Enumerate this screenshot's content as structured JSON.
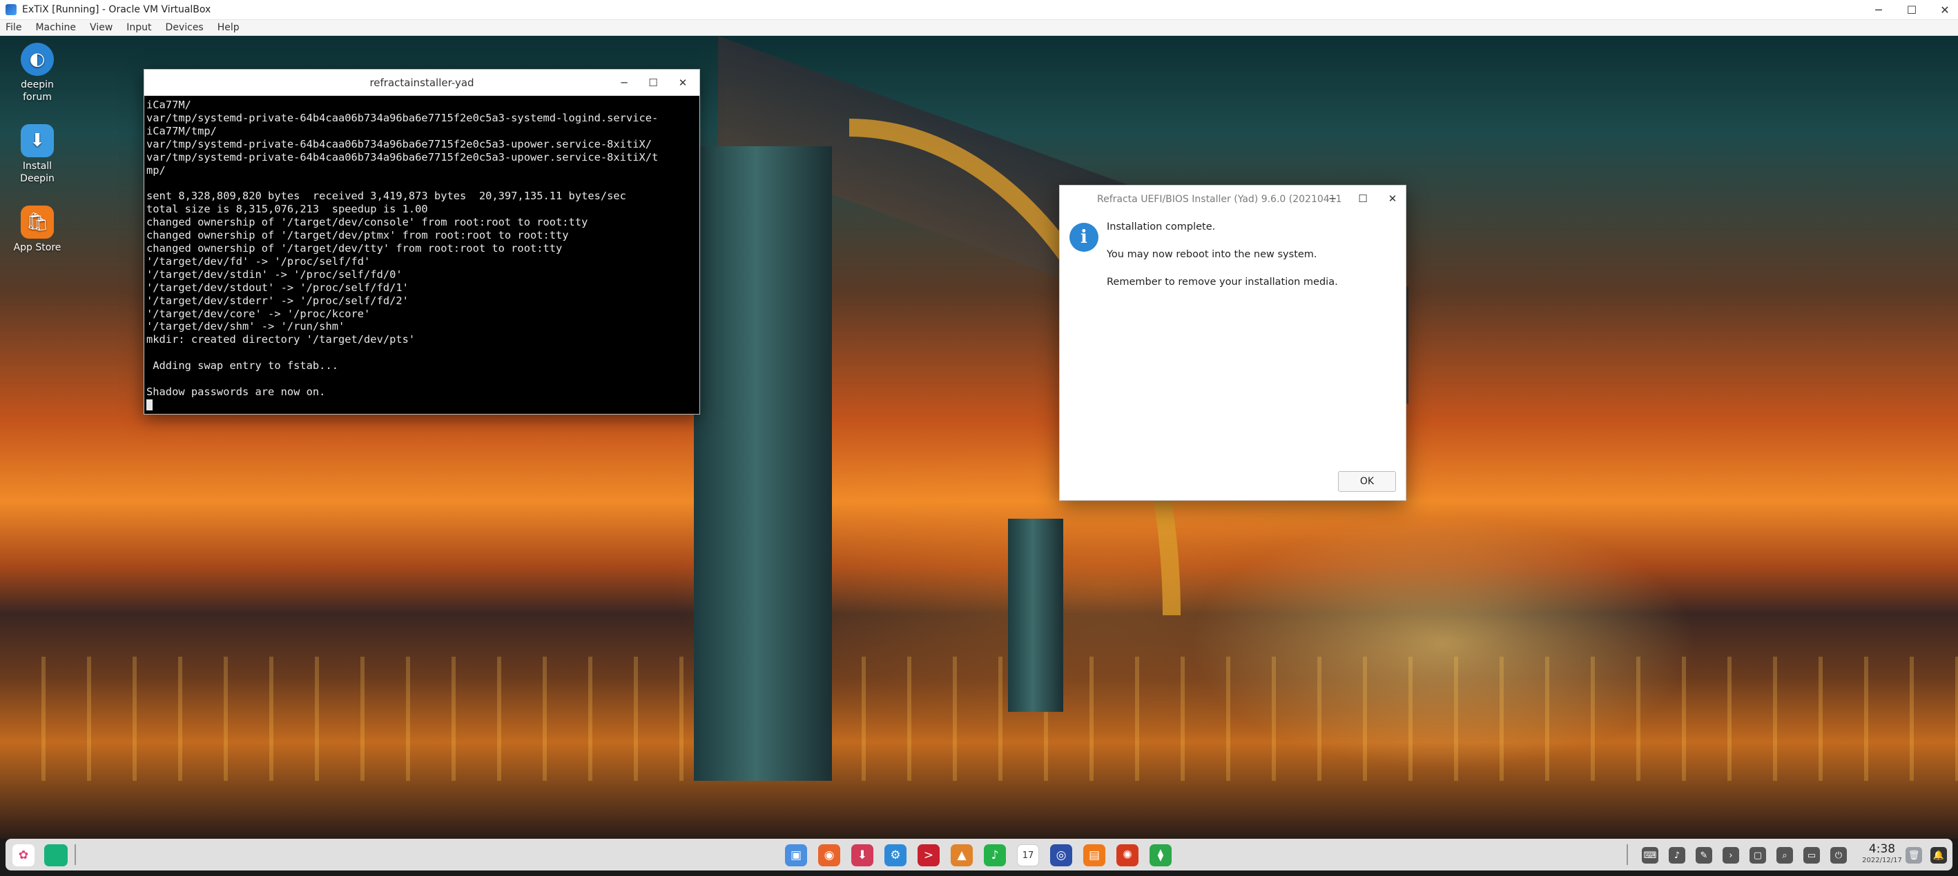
{
  "host": {
    "title": "ExTiX [Running] - Oracle VM VirtualBox",
    "menu": [
      "File",
      "Machine",
      "View",
      "Input",
      "Devices",
      "Help"
    ],
    "controls": {
      "minimize": "─",
      "maximize": "☐",
      "close": "✕"
    }
  },
  "desktop_icons": [
    {
      "label_line1": "deepin",
      "label_line2": "forum",
      "icon": "deepin-forum-icon",
      "glyph": "◐"
    },
    {
      "label_line1": "Install",
      "label_line2": "Deepin",
      "icon": "install-deepin-icon",
      "glyph": "⬇"
    },
    {
      "label_line1": "App Store",
      "label_line2": "",
      "icon": "app-store-icon",
      "glyph": "🛍"
    }
  ],
  "terminal": {
    "title": "refractainstaller-yad",
    "lines": [
      "iCa77M/",
      "var/tmp/systemd-private-64b4caa06b734a96ba6e7715f2e0c5a3-systemd-logind.service-",
      "iCa77M/tmp/",
      "var/tmp/systemd-private-64b4caa06b734a96ba6e7715f2e0c5a3-upower.service-8xitiX/",
      "var/tmp/systemd-private-64b4caa06b734a96ba6e7715f2e0c5a3-upower.service-8xitiX/t",
      "mp/",
      "",
      "sent 8,328,809,820 bytes  received 3,419,873 bytes  20,397,135.11 bytes/sec",
      "total size is 8,315,076,213  speedup is 1.00",
      "changed ownership of '/target/dev/console' from root:root to root:tty",
      "changed ownership of '/target/dev/ptmx' from root:root to root:tty",
      "changed ownership of '/target/dev/tty' from root:root to root:tty",
      "'/target/dev/fd' -> '/proc/self/fd'",
      "'/target/dev/stdin' -> '/proc/self/fd/0'",
      "'/target/dev/stdout' -> '/proc/self/fd/1'",
      "'/target/dev/stderr' -> '/proc/self/fd/2'",
      "'/target/dev/core' -> '/proc/kcore'",
      "'/target/dev/shm' -> '/run/shm'",
      "mkdir: created directory '/target/dev/pts'",
      "",
      " Adding swap entry to fstab...",
      "",
      "Shadow passwords are now on."
    ],
    "controls": {
      "minimize": "─",
      "maximize": "☐",
      "close": "✕"
    }
  },
  "dialog": {
    "title": "Refracta UEFI/BIOS Installer (Yad) 9.6.0 (20210411",
    "icon_glyph": "i",
    "message_1": "Installation complete.",
    "message_2": "You may now reboot into the new system.",
    "message_3": "Remember to remove your installation media.",
    "ok_label": "OK",
    "controls": {
      "minimize": "─",
      "maximize": "☐",
      "close": "✕"
    }
  },
  "dock": {
    "launcher_glyph": "✿",
    "left_items": [
      {
        "name": "launcher-icon",
        "color": "#ffffff"
      },
      {
        "name": "multitasking-view-icon",
        "color": "#16b27a"
      }
    ],
    "apps": [
      {
        "name": "file-manager-icon",
        "color": "#4a8fe0",
        "glyph": "▣"
      },
      {
        "name": "firefox-icon",
        "color": "#e8642a",
        "glyph": "◉"
      },
      {
        "name": "downloader-icon",
        "color": "#d23a5a",
        "glyph": "⬇"
      },
      {
        "name": "settings-gear-icon",
        "color": "#2e8ad8",
        "glyph": "⚙"
      },
      {
        "name": "terminal-icon",
        "color": "#c8202e",
        "glyph": ">"
      },
      {
        "name": "image-viewer-icon",
        "color": "#e0832a",
        "glyph": "▲"
      },
      {
        "name": "music-icon",
        "color": "#26b24a",
        "glyph": "♪"
      },
      {
        "name": "calendar-icon",
        "color": "#ffffff",
        "glyph": "17"
      },
      {
        "name": "system-monitor-icon",
        "color": "#2d4fa8",
        "glyph": "◎"
      },
      {
        "name": "app-store-dock-icon",
        "color": "#f07a1a",
        "glyph": "▤"
      },
      {
        "name": "control-center-icon",
        "color": "#d63a1e",
        "glyph": "✺"
      },
      {
        "name": "installer-icon",
        "color": "#2aa84a",
        "glyph": "⧫"
      }
    ],
    "tray": [
      {
        "name": "keyboard-icon",
        "glyph": "⌨"
      },
      {
        "name": "volume-icon",
        "glyph": "♪"
      },
      {
        "name": "brush-icon",
        "glyph": "✎"
      },
      {
        "name": "expand-arrow-icon",
        "glyph": "›"
      },
      {
        "name": "screenshot-icon",
        "glyph": "▢"
      },
      {
        "name": "search-icon",
        "glyph": "⌕"
      },
      {
        "name": "display-icon",
        "glyph": "▭"
      },
      {
        "name": "power-icon",
        "glyph": "⏻"
      }
    ],
    "time": "4:38",
    "date": "2022/12/17",
    "trash_glyph": "🗑",
    "notification_glyph": "🔔"
  }
}
